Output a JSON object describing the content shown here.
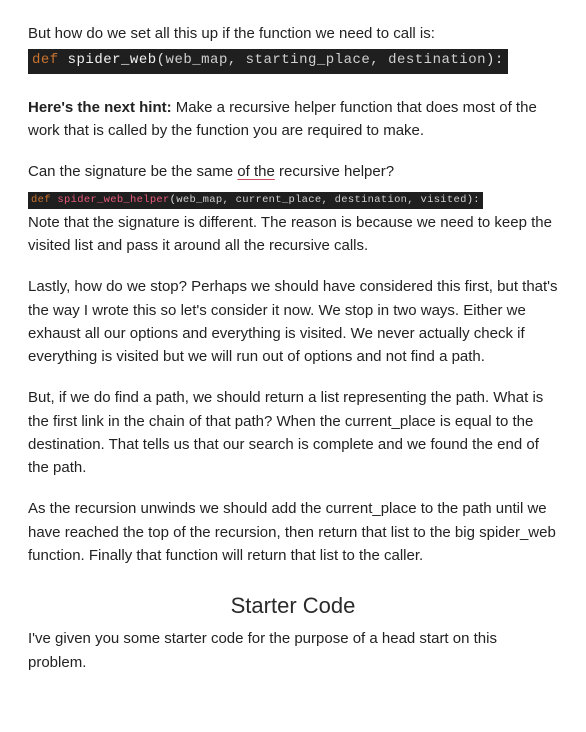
{
  "p_intro_line": "But how do we set all this up if the function we need to call is:",
  "code1": {
    "kw": "def",
    "fn": "spider_web",
    "open": "(",
    "params": "web_map, starting_place, destination",
    "close": "):"
  },
  "hint_label": "Here's the next hint:",
  "hint_text": " Make a recursive helper function that does most of the work that is called by the function you are required to make.",
  "p_signature_q_pre": "Can the signature be the same ",
  "p_signature_q_under": "of the",
  "p_signature_q_post": " recursive helper?",
  "code2": {
    "kw": "def",
    "fn": "spider_web_helper",
    "open": "(",
    "params": "web_map, current_place, destination, visited",
    "close": "):"
  },
  "p_signature_note": "Note that the signature is different.  The reason is because we need to keep the visited list and pass it around all the recursive calls.",
  "p_stop": "Lastly, how do we stop?  Perhaps we should have considered this first, but that's the way I wrote this so let's consider it now.  We stop in two ways.  Either we exhaust all our options and everything is visited.  We never actually check if everything is visited but we will run out of options and not find a path.",
  "p_found": "But, if we do find a path, we should return a list representing the path.  What is the first link in the chain of that path?  When the current_place is equal to the destination.  That tells us that our search is complete and we found the end of the path.",
  "p_unwind": "As the recursion unwinds we should add the current_place to the path until we have reached the top of the recursion, then return that list to the big spider_web function.  Finally that function will return that list to the caller.",
  "h_starter": "Starter Code",
  "p_starter": "I've given you some starter code for the purpose of a head start on this problem."
}
